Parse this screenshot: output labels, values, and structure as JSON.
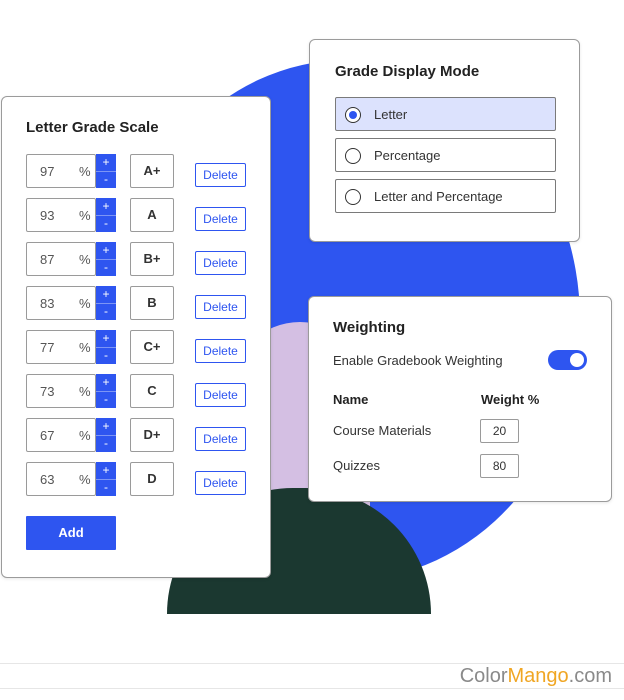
{
  "grade_scale": {
    "title": "Letter Grade Scale",
    "percent_sign": "%",
    "increment_label": "+",
    "decrement_label": "-",
    "delete_label": "Delete",
    "add_label": "Add",
    "rows": [
      {
        "percent": "97",
        "letter": "A+"
      },
      {
        "percent": "93",
        "letter": "A"
      },
      {
        "percent": "87",
        "letter": "B+"
      },
      {
        "percent": "83",
        "letter": "B"
      },
      {
        "percent": "77",
        "letter": "C+"
      },
      {
        "percent": "73",
        "letter": "C"
      },
      {
        "percent": "67",
        "letter": "D+"
      },
      {
        "percent": "63",
        "letter": "D"
      }
    ]
  },
  "display_mode": {
    "title": "Grade Display Mode",
    "options": [
      {
        "label": "Letter",
        "selected": true
      },
      {
        "label": "Percentage",
        "selected": false
      },
      {
        "label": "Letter and Percentage",
        "selected": false
      }
    ]
  },
  "weighting": {
    "title": "Weighting",
    "toggle_label": "Enable Gradebook Weighting",
    "toggle_on": true,
    "col_name": "Name",
    "col_weight": "Weight %",
    "items": [
      {
        "name": "Course Materials",
        "weight": "20"
      },
      {
        "name": "Quizzes",
        "weight": "80"
      }
    ]
  },
  "brand": {
    "part1": "Color",
    "part2": "Mango",
    "part3": ".com"
  },
  "colors": {
    "accent": "#2e55f0",
    "selected_bg": "#dce2fd",
    "lavender": "#d4bfe3",
    "dark_green": "#1b3830",
    "brand_orange": "#f0a623"
  }
}
